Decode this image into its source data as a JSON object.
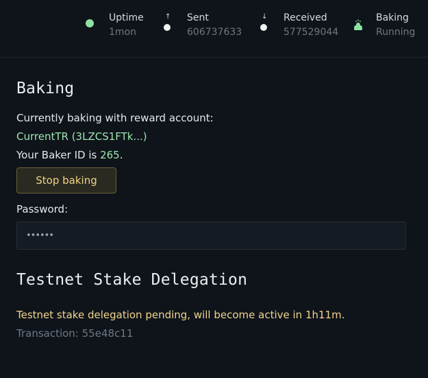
{
  "status": {
    "uptime": {
      "label": "Uptime",
      "value": "1mon",
      "icon": "status-dot-icon"
    },
    "sent": {
      "label": "Sent",
      "value": "606737633",
      "icon": "arrow-up-icon"
    },
    "received": {
      "label": "Received",
      "value": "577529044",
      "icon": "arrow-down-icon"
    },
    "baking": {
      "label": "Baking",
      "value": "Running",
      "icon": "baker-icon"
    }
  },
  "baking": {
    "title": "Baking",
    "currently_baking_text": "Currently baking with reward account:",
    "reward_account": "CurrentTR (3LZCS1FTk...)",
    "baker_id_prefix": "Your Baker ID is ",
    "baker_id": "265",
    "baker_id_suffix": ".",
    "stop_button_label": "Stop baking",
    "password_label": "Password:",
    "password_value": "••••••"
  },
  "delegation": {
    "title": "Testnet Stake Delegation",
    "pending_text": "Testnet stake delegation pending, will become active in 1h11m.",
    "transaction_label": "Transaction: ",
    "transaction_id": "55e48c11"
  },
  "colors": {
    "background": "#0f141b",
    "accent_green": "#9ee6ae",
    "accent_amber": "#f2d48a",
    "muted": "#6f7782"
  }
}
